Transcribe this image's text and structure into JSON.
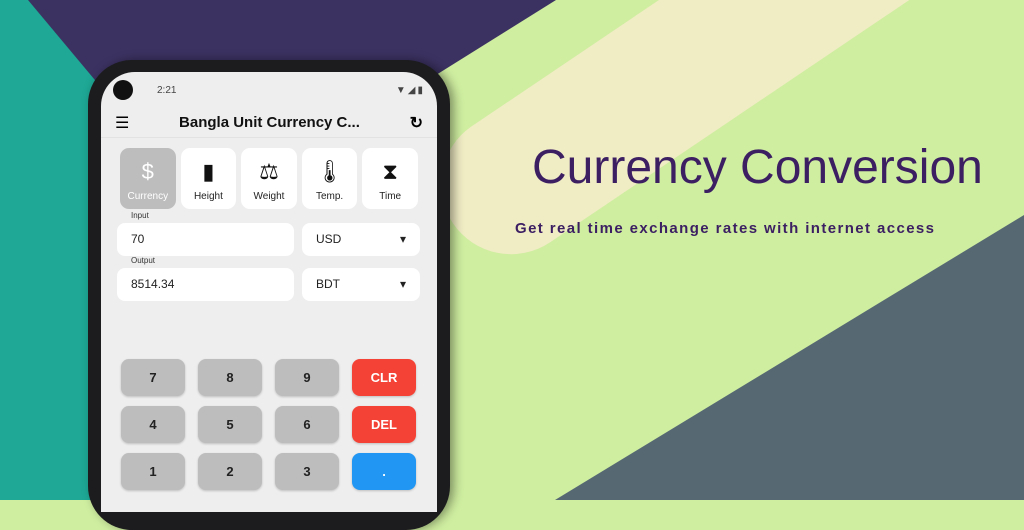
{
  "status": {
    "time": "2:21",
    "icons": "▼◢▮"
  },
  "appbar": {
    "title": "Bangla Unit Currency C...",
    "menu_icon": "☰",
    "refresh_icon": "↻"
  },
  "tiles": [
    {
      "label": "Currency",
      "icon": "$"
    },
    {
      "label": "Height",
      "icon": "▮"
    },
    {
      "label": "Weight",
      "icon": "⚖"
    },
    {
      "label": "Temp.",
      "icon": "🌡"
    },
    {
      "label": "Time",
      "icon": "⧗"
    }
  ],
  "input": {
    "label": "Input",
    "value": "70",
    "unit": "USD"
  },
  "output": {
    "label": "Output",
    "value": "8514.34",
    "unit": "BDT"
  },
  "keys": [
    "7",
    "8",
    "9",
    "CLR",
    "4",
    "5",
    "6",
    "DEL",
    "1",
    "2",
    "3",
    "."
  ],
  "promo": {
    "title": "Currency Conversion",
    "subtitle": "Get real time exchange rates with internet access"
  }
}
